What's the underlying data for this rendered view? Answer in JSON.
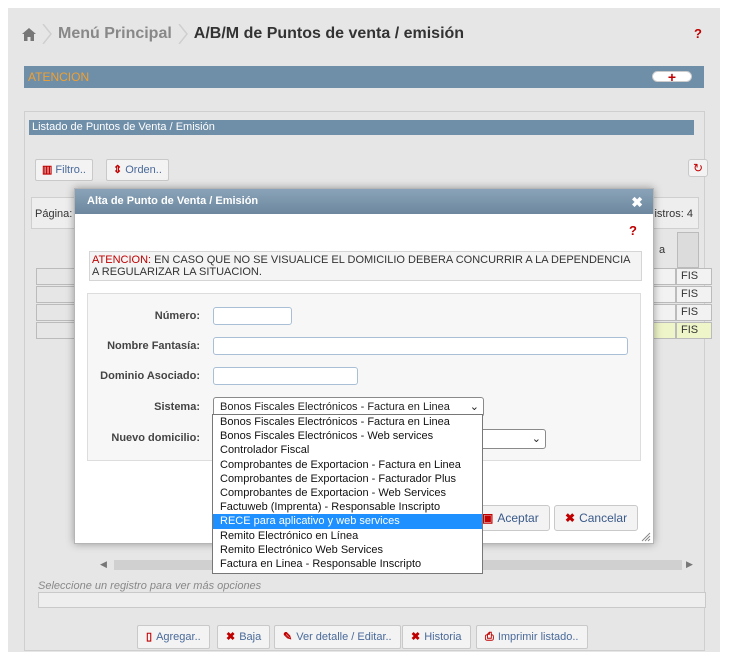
{
  "breadcrumb": {
    "item1": "Menú Principal",
    "item2": "A/B/M de Puntos de venta / emisión",
    "help": "?"
  },
  "atencion": {
    "title": "ATENCION",
    "plus": "+"
  },
  "list": {
    "title": "Listado de Puntos de Venta / Emisión",
    "filter_label": "Filtro..",
    "order_label": "Orden..",
    "page_label": "Página:",
    "records_label": "istros: 4",
    "header_partial": "a",
    "cells": [
      "FIS",
      "FIS",
      "FIS",
      "FIS"
    ],
    "hint": "Seleccione un registro para ver más opciones"
  },
  "bottom_buttons": {
    "add": "Agregar..",
    "delete": "Baja",
    "detail": "Ver detalle / Editar..",
    "history": "Historia",
    "print": "Imprimir listado.."
  },
  "modal": {
    "title": "Alta de Punto de Venta / Emisión",
    "close": "✖",
    "help": "?",
    "warning_prefix": "ATENCION:",
    "warning_text": " EN CASO QUE NO SE VISUALICE EL DOMICILIO DEBERA CONCURRIR A LA DEPENDENCIA A REGULARIZAR LA SITUACION.",
    "labels": {
      "numero": "Número:",
      "nombre": "Nombre Fantasía:",
      "dominio": "Dominio Asociado:",
      "sistema": "Sistema:",
      "domicilio": "Nuevo domicilio:"
    },
    "values": {
      "numero": "",
      "nombre": "",
      "dominio": ""
    },
    "sistema_selected": "Bonos Fiscales Electrónicos - Factura en Linea",
    "domicilio_selected": "",
    "accept": "Aceptar",
    "cancel": "Cancelar"
  },
  "sistema_options": [
    "Bonos Fiscales Electrónicos - Factura en Linea",
    "Bonos Fiscales Electrónicos - Web services",
    "Controlador Fiscal",
    "Comprobantes de Exportacion - Factura en Linea",
    "Comprobantes de Exportacion - Facturador Plus",
    "Comprobantes de Exportacion - Web Services",
    "Factuweb (Imprenta) - Responsable Inscripto",
    "RECE para aplicativo y web services",
    "Remito Electrónico en Línea",
    "Remito Electrónico Web Services",
    "Factura en Linea - Responsable Inscripto"
  ],
  "highlighted_option_index": 7,
  "colors": {
    "header_bar": "#6f8ea8",
    "accent_red": "#c00000",
    "highlight": "#1e90ff",
    "selected_row": "#eef5c8"
  }
}
